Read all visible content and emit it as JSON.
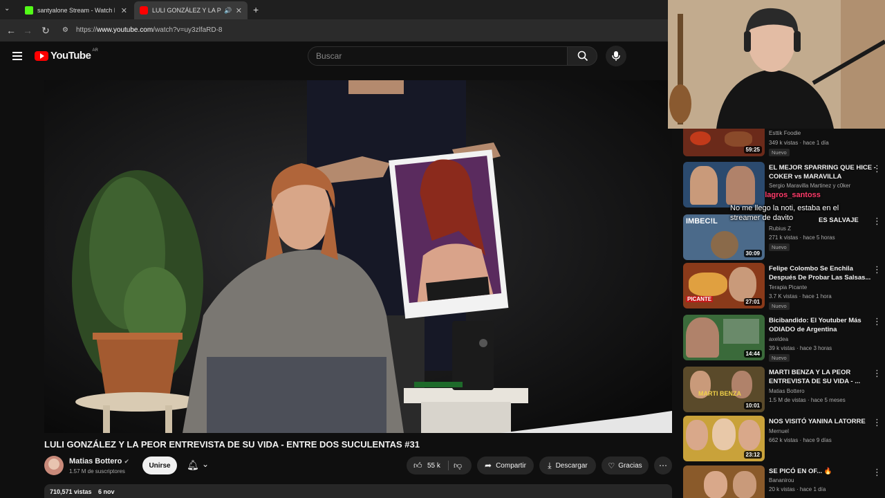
{
  "browser": {
    "tabs": [
      {
        "title": "santyalone Stream - Watch Live"
      },
      {
        "title": "LULI GONZÁLEZ Y LA PEOR"
      }
    ],
    "url_prefix": "https://",
    "url_domain": "www.youtube.com",
    "url_path": "/watch?v=uy3zlfaRD-8"
  },
  "yt": {
    "logo_text": "YouTube",
    "region": "AR",
    "search_placeholder": "Buscar"
  },
  "video": {
    "title": "LULI GONZÁLEZ Y LA PEOR ENTREVISTA DE SU VIDA - ENTRE DOS SUCULENTAS #31",
    "channel": "Matias Bottero",
    "subscribers": "1.57 M de suscriptores",
    "join_label": "Unirse",
    "likes": "55 k",
    "share_label": "Compartir",
    "download_label": "Descargar",
    "thanks_label": "Gracias",
    "views": "710,571 vistas",
    "date": "6 nov"
  },
  "overlay": {
    "chat_user": "Milagros_santoss",
    "chat_message": "No me llego la noti, estaba en el streamer de davito"
  },
  "recommendations": [
    {
      "title": "",
      "channel": "Esttik Foodie",
      "meta": "349 k vistas · hace 1 día",
      "badge": "Nuevo",
      "duration": "59:25",
      "color": "#6b2a1a"
    },
    {
      "title": "EL MEJOR SPARRING QUE HICE - COKER vs MARAVILLA",
      "channel": "Sergio Maravilla Martinez y c0ker",
      "meta": "",
      "badge": "",
      "duration": "",
      "color": "#2b4a6e"
    },
    {
      "title": "ES SALVAJE",
      "channel": "Rubius Z",
      "meta": "271 k vistas · hace 5 horas",
      "badge": "Nuevo",
      "duration": "30:09",
      "color": "#4b6a8a"
    },
    {
      "title": "Felipe Colombo Se Enchila Después De Probar Las Salsas...",
      "channel": "Terapia Picante",
      "meta": "3.7 K vistas · hace 1 hora",
      "badge": "Nuevo",
      "duration": "27:01",
      "color": "#8a3a1a"
    },
    {
      "title": "Bicibandido: El Youtuber Más ODIADO de Argentina",
      "channel": "axeldea",
      "meta": "39 k vistas · hace 3 horas",
      "badge": "Nuevo",
      "duration": "14:44",
      "color": "#3a6a3a"
    },
    {
      "title": "MARTI BENZA Y LA PEOR ENTREVISTA DE SU VIDA - ...",
      "channel": "Matias Bottero",
      "meta": "1.5 M de vistas · hace 5 meses",
      "badge": "",
      "duration": "10:01",
      "color": "#5a4a2a"
    },
    {
      "title": "NOS VISITÓ YANINA LATORRE",
      "channel": "Mernuel",
      "meta": "662 k vistas · hace 9 días",
      "badge": "",
      "duration": "23:12",
      "color": "#c9a23a"
    },
    {
      "title": "SE PICÓ EN OF... 🔥",
      "channel": "Bananirou",
      "meta": "20 k vistas · hace 1 día",
      "badge": "",
      "duration": "",
      "color": "#8a5a2a"
    }
  ]
}
